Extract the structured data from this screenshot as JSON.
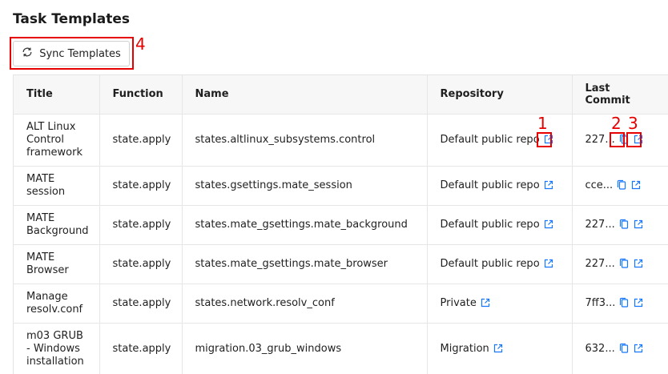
{
  "page": {
    "title": "Task Templates"
  },
  "toolbar": {
    "sync_label": "Sync Templates"
  },
  "annotations": [
    "1",
    "2",
    "3",
    "4"
  ],
  "table": {
    "headers": [
      "Title",
      "Function",
      "Name",
      "Repository",
      "Last Commit"
    ],
    "rows": [
      {
        "title": "ALT Linux Control framework",
        "function": "state.apply",
        "name": "states.altlinux_subsystems.control",
        "repository": "Default public repo",
        "commit": "227..."
      },
      {
        "title": "MATE session",
        "function": "state.apply",
        "name": "states.gsettings.mate_session",
        "repository": "Default public repo",
        "commit": "cce..."
      },
      {
        "title": "MATE Background",
        "function": "state.apply",
        "name": "states.mate_gsettings.mate_background",
        "repository": "Default public repo",
        "commit": "227..."
      },
      {
        "title": "MATE Browser",
        "function": "state.apply",
        "name": "states.mate_gsettings.mate_browser",
        "repository": "Default public repo",
        "commit": "227..."
      },
      {
        "title": "Manage resolv.conf",
        "function": "state.apply",
        "name": "states.network.resolv_conf",
        "repository": "Private",
        "commit": "7ff3..."
      },
      {
        "title": "m03 GRUB - Windows installation",
        "function": "state.apply",
        "name": "migration.03_grub_windows",
        "repository": "Migration",
        "commit": "632..."
      }
    ]
  },
  "colors": {
    "accent": "#1677ff",
    "annotation": "#e60000",
    "header_bg": "#f7f7f7",
    "border": "#e6e6e6"
  },
  "icons": {
    "sync": "sync-icon",
    "external": "external-link-icon",
    "copy": "copy-icon"
  }
}
